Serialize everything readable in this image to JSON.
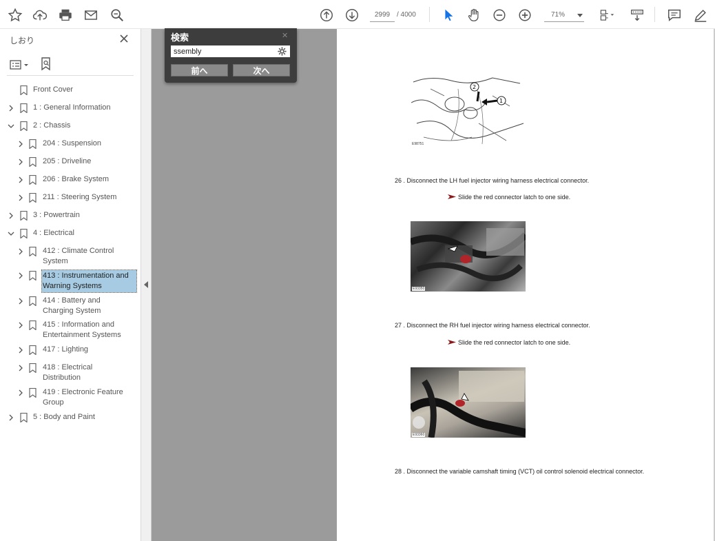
{
  "toolbar": {
    "page_current": "2999",
    "page_total": "/ 4000",
    "zoom": "71%"
  },
  "sidebar": {
    "title": "しおり",
    "items": [
      {
        "label": "Front Cover",
        "has_chevron": false,
        "expanded": false
      },
      {
        "label": "1 : General Information",
        "has_chevron": true,
        "expanded": false
      },
      {
        "label": "2 : Chassis",
        "has_chevron": true,
        "expanded": true
      },
      {
        "label": "204 : Suspension",
        "has_chevron": true,
        "expanded": false
      },
      {
        "label": "205 : Driveline",
        "has_chevron": true,
        "expanded": false
      },
      {
        "label": "206 : Brake System",
        "has_chevron": true,
        "expanded": false
      },
      {
        "label": "211 : Steering System",
        "has_chevron": true,
        "expanded": false
      },
      {
        "label": "3 : Powertrain",
        "has_chevron": true,
        "expanded": false
      },
      {
        "label": "4 : Electrical",
        "has_chevron": true,
        "expanded": true
      },
      {
        "label": "412 : Climate Control System",
        "has_chevron": true,
        "expanded": false
      },
      {
        "label": "413 : Instrumentation and Warning Systems",
        "has_chevron": true,
        "expanded": false,
        "selected": true
      },
      {
        "label": "414 : Battery and Charging System",
        "has_chevron": true,
        "expanded": false
      },
      {
        "label": "415 : Information and Entertainment Systems",
        "has_chevron": true,
        "expanded": false
      },
      {
        "label": "417 : Lighting",
        "has_chevron": true,
        "expanded": false
      },
      {
        "label": "418 : Electrical Distribution",
        "has_chevron": true,
        "expanded": false
      },
      {
        "label": "419 : Electronic Feature Group",
        "has_chevron": true,
        "expanded": false
      },
      {
        "label": "5 : Body and Paint",
        "has_chevron": true,
        "expanded": false
      }
    ]
  },
  "find": {
    "title": "検索",
    "query": "ssembly",
    "prev_label": "前へ",
    "next_label": "次へ"
  },
  "document": {
    "figure1_code": "E98751",
    "step26": "26 . Disconnect the LH fuel injector wiring harness electrical connector.",
    "note1": "Slide the red connector latch to one side.",
    "figure2_code": "E93350",
    "step27": "27 . Disconnect the RH fuel injector wiring harness electrical connector.",
    "note2": "Slide the red connector latch to one side.",
    "figure3_code": "E93360",
    "step28": "28 . Disconnect the variable camshaft timing (VCT) oil control solenoid electrical connector."
  },
  "colors": {
    "selected_bg": "#a6cbe3",
    "gray_workspace": "#9b9b9b",
    "find_panel": "#3d3d3d",
    "accent_blue": "#1473e6"
  }
}
